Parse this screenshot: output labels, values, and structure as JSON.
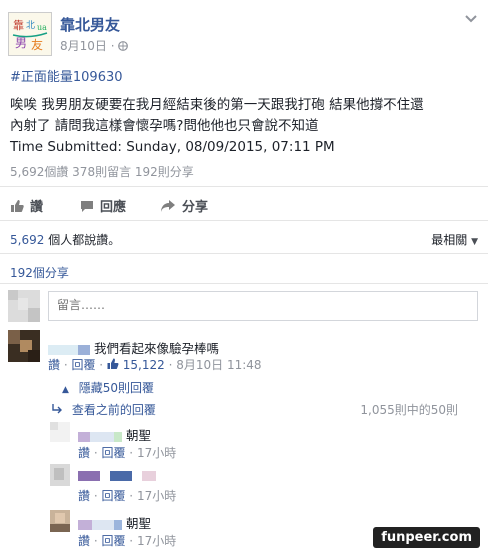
{
  "post": {
    "page_name": "靠北男友",
    "date": "8月10日",
    "hashtag": "#正面能量109630",
    "body_line1": "唉唉 我男朋友硬要在我月經結束後的第一天跟我打砲 結果他撐不住還",
    "body_line2": "內射了 請問我這樣會懷孕嗎?問他他也只會說不知道",
    "time_submitted": "Time Submitted: Sunday, 08/09/2015, 07:11 PM",
    "stats": "5,692個讚   378則留言   192則分享"
  },
  "actions": {
    "like": "讚",
    "comment": "回應",
    "share": "分享"
  },
  "likes_summary": {
    "count": "5,692",
    "text": "個人都說讚。",
    "sort_label": "最相關"
  },
  "shares_label": "192個分享",
  "comment_input": {
    "placeholder": "留言……"
  },
  "comments": [
    {
      "text": "我們看起來像驗孕棒嗎",
      "like_label": "讚",
      "reply_label": "回覆",
      "likes": "15,122",
      "time": "8月10日 11:48"
    }
  ],
  "hidden_replies": "隱藏50則回覆",
  "view_previous": "查看之前的回覆",
  "reply_count": "1,055則中的50則",
  "replies": [
    {
      "text": "朝聖",
      "like_label": "讚",
      "reply_label": "回覆",
      "time": "17小時"
    },
    {
      "text": "",
      "like_label": "讚",
      "reply_label": "回覆",
      "time": "17小時"
    },
    {
      "text": "朝聖",
      "like_label": "讚",
      "reply_label": "回覆",
      "time": "17小時"
    }
  ],
  "watermark": "funpeer.com",
  "colors": {
    "link": "#365899",
    "muted": "#90949c",
    "text": "#1d2129"
  }
}
